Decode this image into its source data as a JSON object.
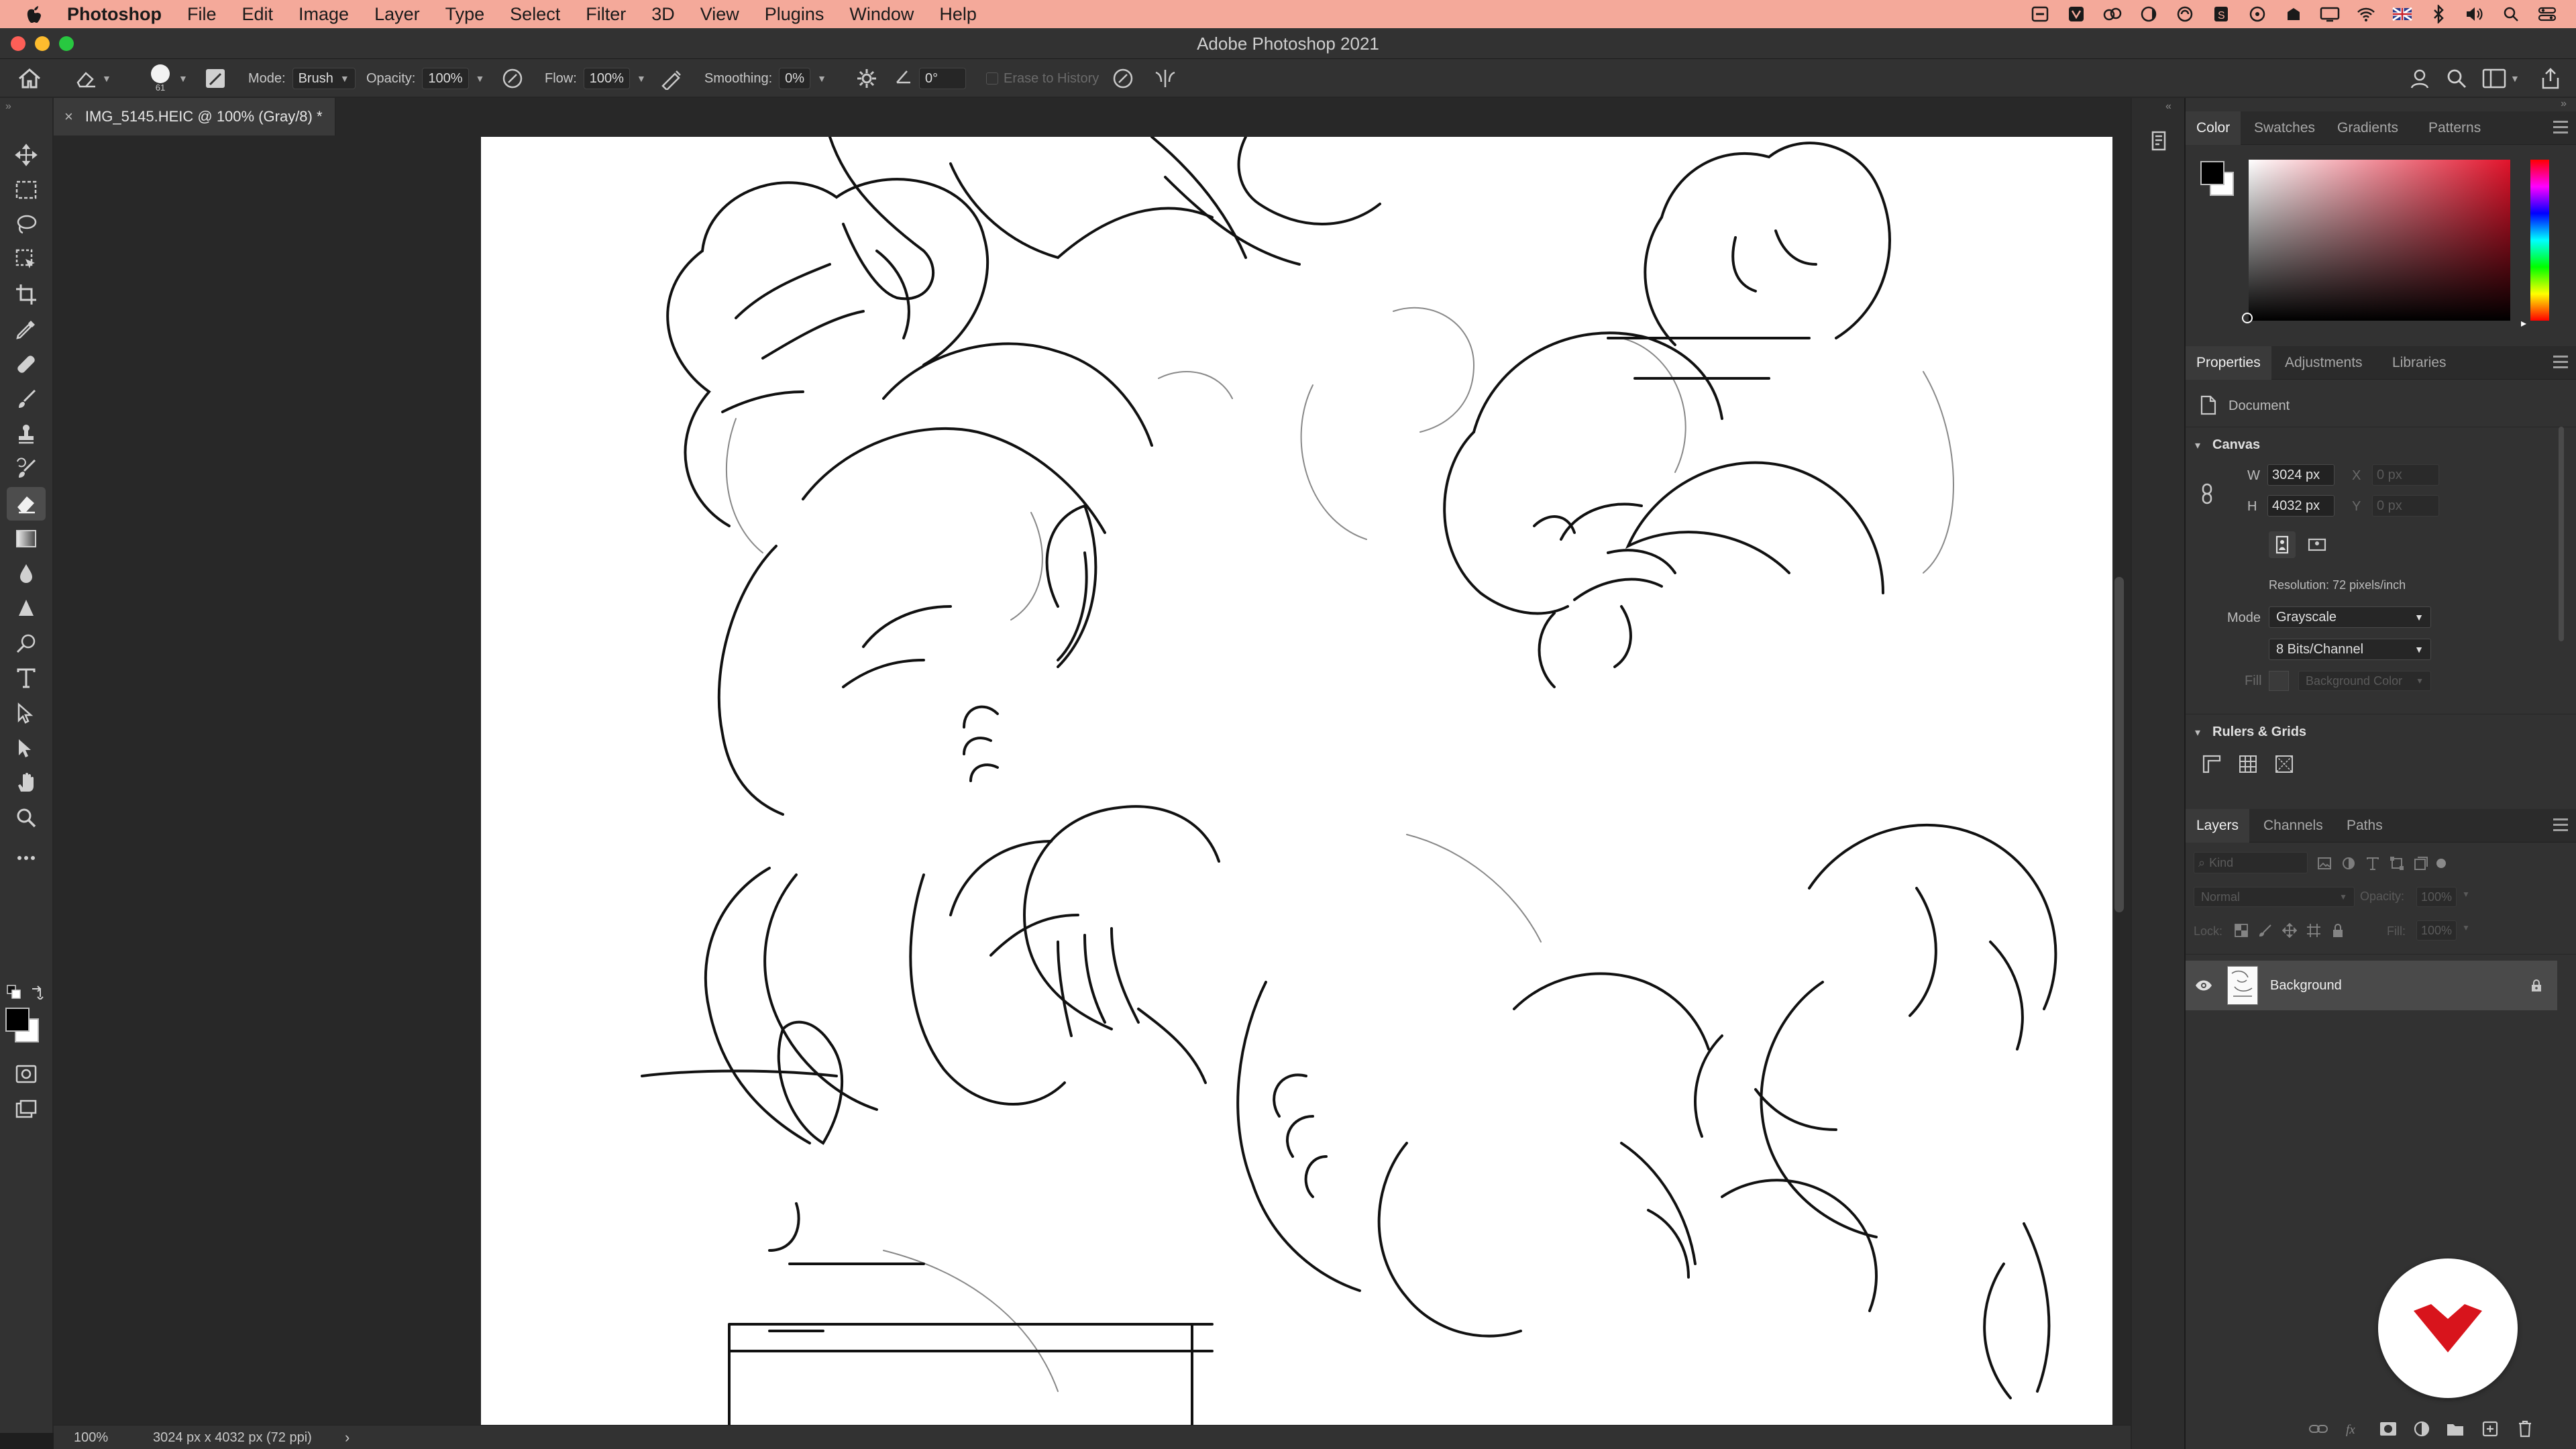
{
  "menubar": {
    "items": [
      "Photoshop",
      "File",
      "Edit",
      "Image",
      "Layer",
      "Type",
      "Select",
      "Filter",
      "3D",
      "View",
      "Plugins",
      "Window",
      "Help"
    ],
    "tray_icons": [
      "pdf-icon",
      "app-icon",
      "cc-icon",
      "do-not-disturb-icon",
      "sync-icon",
      "script-icon",
      "dropbox-icon",
      "backup-icon",
      "display-icon",
      "wifi-icon",
      "flag-icon",
      "bluetooth-icon",
      "volume-icon",
      "search-icon",
      "control-center-icon"
    ]
  },
  "window": {
    "title": "Adobe Photoshop 2021"
  },
  "options_bar": {
    "brush_size": "61",
    "mode_label": "Mode:",
    "mode_value": "Brush",
    "opacity_label": "Opacity:",
    "opacity_value": "100%",
    "flow_label": "Flow:",
    "flow_value": "100%",
    "smoothing_label": "Smoothing:",
    "smoothing_value": "0%",
    "angle_value": "0°",
    "erase_history_label": "Erase to History"
  },
  "document": {
    "tab_title": "IMG_5145.HEIC @ 100% (Gray/8) *",
    "tab_close": "×"
  },
  "status_bar": {
    "zoom": "100%",
    "info": "3024 px x 4032 px (72 ppi)",
    "arrow": "›"
  },
  "color_panel": {
    "tabs": [
      "Color",
      "Swatches",
      "Gradients",
      "Patterns"
    ],
    "foreground": "#000000",
    "background": "#ffffff",
    "hue_color": "#e2132b"
  },
  "properties_panel": {
    "tabs": [
      "Properties",
      "Adjustments",
      "Libraries"
    ],
    "doc_label": "Document",
    "canvas_section": "Canvas",
    "w_label": "W",
    "w_value": "3024 px",
    "h_label": "H",
    "h_value": "4032 px",
    "x_label": "X",
    "x_placeholder": "0 px",
    "y_label": "Y",
    "y_placeholder": "0 px",
    "resolution": "Resolution: 72 pixels/inch",
    "mode_label": "Mode",
    "mode_value": "Grayscale",
    "bits_value": "8 Bits/Channel",
    "fill_label": "Fill",
    "fill_value": "Background Color",
    "rulers_section": "Rulers & Grids"
  },
  "layers_panel": {
    "tabs": [
      "Layers",
      "Channels",
      "Paths"
    ],
    "filter_placeholder": "Kind",
    "blend_mode": "Normal",
    "opacity_label": "Opacity:",
    "opacity_value": "100%",
    "lock_label": "Lock:",
    "fill_label": "Fill:",
    "fill_value": "100%",
    "layers": [
      {
        "name": "Background",
        "visible": true,
        "locked": true
      }
    ]
  },
  "accent": {
    "menubar_bg": "#f4a99a",
    "logo_red": "#d8141c",
    "close": "#fe5f57",
    "minimize": "#febc2e",
    "zoom": "#28c840"
  }
}
